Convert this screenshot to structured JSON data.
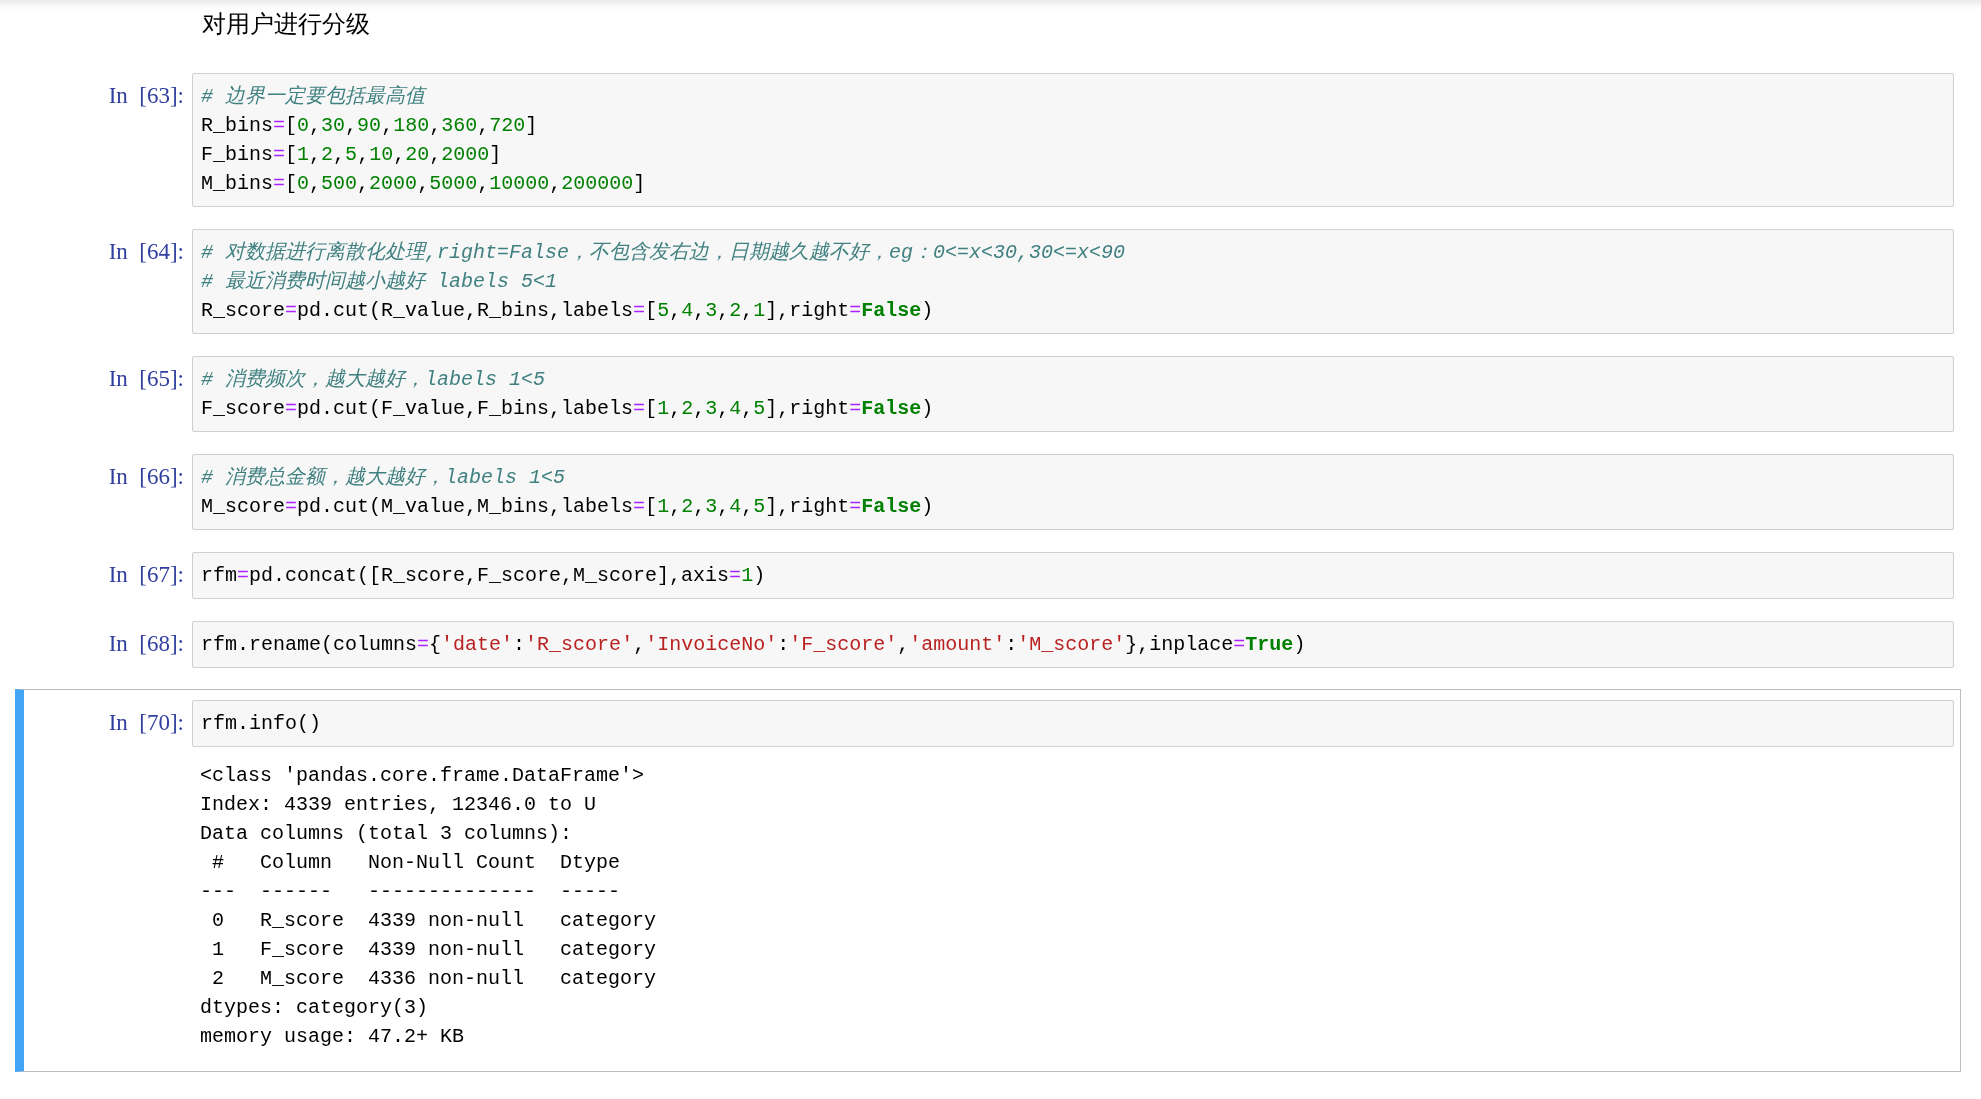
{
  "heading": "对用户进行分级",
  "cells": [
    {
      "prompt": "In  [63]:",
      "selected": false,
      "lines": [
        [
          {
            "kind": "comment",
            "text": "# 边界一定要包括最高值"
          }
        ],
        [
          {
            "kind": "plain",
            "text": "R_bins"
          },
          {
            "kind": "op",
            "text": "="
          },
          {
            "kind": "plain",
            "text": "["
          },
          {
            "kind": "num",
            "text": "0"
          },
          {
            "kind": "plain",
            "text": ","
          },
          {
            "kind": "num",
            "text": "30"
          },
          {
            "kind": "plain",
            "text": ","
          },
          {
            "kind": "num",
            "text": "90"
          },
          {
            "kind": "plain",
            "text": ","
          },
          {
            "kind": "num",
            "text": "180"
          },
          {
            "kind": "plain",
            "text": ","
          },
          {
            "kind": "num",
            "text": "360"
          },
          {
            "kind": "plain",
            "text": ","
          },
          {
            "kind": "num",
            "text": "720"
          },
          {
            "kind": "plain",
            "text": "]"
          }
        ],
        [
          {
            "kind": "plain",
            "text": "F_bins"
          },
          {
            "kind": "op",
            "text": "="
          },
          {
            "kind": "plain",
            "text": "["
          },
          {
            "kind": "num",
            "text": "1"
          },
          {
            "kind": "plain",
            "text": ","
          },
          {
            "kind": "num",
            "text": "2"
          },
          {
            "kind": "plain",
            "text": ","
          },
          {
            "kind": "num",
            "text": "5"
          },
          {
            "kind": "plain",
            "text": ","
          },
          {
            "kind": "num",
            "text": "10"
          },
          {
            "kind": "plain",
            "text": ","
          },
          {
            "kind": "num",
            "text": "20"
          },
          {
            "kind": "plain",
            "text": ","
          },
          {
            "kind": "num",
            "text": "2000"
          },
          {
            "kind": "plain",
            "text": "]"
          }
        ],
        [
          {
            "kind": "plain",
            "text": "M_bins"
          },
          {
            "kind": "op",
            "text": "="
          },
          {
            "kind": "plain",
            "text": "["
          },
          {
            "kind": "num",
            "text": "0"
          },
          {
            "kind": "plain",
            "text": ","
          },
          {
            "kind": "num",
            "text": "500"
          },
          {
            "kind": "plain",
            "text": ","
          },
          {
            "kind": "num",
            "text": "2000"
          },
          {
            "kind": "plain",
            "text": ","
          },
          {
            "kind": "num",
            "text": "5000"
          },
          {
            "kind": "plain",
            "text": ","
          },
          {
            "kind": "num",
            "text": "10000"
          },
          {
            "kind": "plain",
            "text": ","
          },
          {
            "kind": "num",
            "text": "200000"
          },
          {
            "kind": "plain",
            "text": "]"
          }
        ]
      ]
    },
    {
      "prompt": "In  [64]:",
      "selected": false,
      "lines": [
        [
          {
            "kind": "comment",
            "text": "# 对数据进行离散化处理,right=False，不包含发右边，日期越久越不好，eg：0<=x<30,30<=x<90"
          }
        ],
        [
          {
            "kind": "comment",
            "text": "# 最近消费时间越小越好 labels 5<1"
          }
        ],
        [
          {
            "kind": "plain",
            "text": "R_score"
          },
          {
            "kind": "op",
            "text": "="
          },
          {
            "kind": "plain",
            "text": "pd.cut(R_value,R_bins,labels"
          },
          {
            "kind": "op",
            "text": "="
          },
          {
            "kind": "plain",
            "text": "["
          },
          {
            "kind": "num",
            "text": "5"
          },
          {
            "kind": "plain",
            "text": ","
          },
          {
            "kind": "num",
            "text": "4"
          },
          {
            "kind": "plain",
            "text": ","
          },
          {
            "kind": "num",
            "text": "3"
          },
          {
            "kind": "plain",
            "text": ","
          },
          {
            "kind": "num",
            "text": "2"
          },
          {
            "kind": "plain",
            "text": ","
          },
          {
            "kind": "num",
            "text": "1"
          },
          {
            "kind": "plain",
            "text": "],right"
          },
          {
            "kind": "op",
            "text": "="
          },
          {
            "kind": "keyword",
            "text": "False"
          },
          {
            "kind": "plain",
            "text": ")"
          }
        ]
      ]
    },
    {
      "prompt": "In  [65]:",
      "selected": false,
      "lines": [
        [
          {
            "kind": "comment",
            "text": "# 消费频次，越大越好，labels 1<5"
          }
        ],
        [
          {
            "kind": "plain",
            "text": "F_score"
          },
          {
            "kind": "op",
            "text": "="
          },
          {
            "kind": "plain",
            "text": "pd.cut(F_value,F_bins,labels"
          },
          {
            "kind": "op",
            "text": "="
          },
          {
            "kind": "plain",
            "text": "["
          },
          {
            "kind": "num",
            "text": "1"
          },
          {
            "kind": "plain",
            "text": ","
          },
          {
            "kind": "num",
            "text": "2"
          },
          {
            "kind": "plain",
            "text": ","
          },
          {
            "kind": "num",
            "text": "3"
          },
          {
            "kind": "plain",
            "text": ","
          },
          {
            "kind": "num",
            "text": "4"
          },
          {
            "kind": "plain",
            "text": ","
          },
          {
            "kind": "num",
            "text": "5"
          },
          {
            "kind": "plain",
            "text": "],right"
          },
          {
            "kind": "op",
            "text": "="
          },
          {
            "kind": "keyword",
            "text": "False"
          },
          {
            "kind": "plain",
            "text": ")"
          }
        ]
      ]
    },
    {
      "prompt": "In  [66]:",
      "selected": false,
      "lines": [
        [
          {
            "kind": "comment",
            "text": "# 消费总金额，越大越好，labels 1<5"
          }
        ],
        [
          {
            "kind": "plain",
            "text": "M_score"
          },
          {
            "kind": "op",
            "text": "="
          },
          {
            "kind": "plain",
            "text": "pd.cut(M_value,M_bins,labels"
          },
          {
            "kind": "op",
            "text": "="
          },
          {
            "kind": "plain",
            "text": "["
          },
          {
            "kind": "num",
            "text": "1"
          },
          {
            "kind": "plain",
            "text": ","
          },
          {
            "kind": "num",
            "text": "2"
          },
          {
            "kind": "plain",
            "text": ","
          },
          {
            "kind": "num",
            "text": "3"
          },
          {
            "kind": "plain",
            "text": ","
          },
          {
            "kind": "num",
            "text": "4"
          },
          {
            "kind": "plain",
            "text": ","
          },
          {
            "kind": "num",
            "text": "5"
          },
          {
            "kind": "plain",
            "text": "],right"
          },
          {
            "kind": "op",
            "text": "="
          },
          {
            "kind": "keyword",
            "text": "False"
          },
          {
            "kind": "plain",
            "text": ")"
          }
        ]
      ]
    },
    {
      "prompt": "In  [67]:",
      "selected": false,
      "lines": [
        [
          {
            "kind": "plain",
            "text": "rfm"
          },
          {
            "kind": "op",
            "text": "="
          },
          {
            "kind": "plain",
            "text": "pd.concat([R_score,F_score,M_score],axis"
          },
          {
            "kind": "op",
            "text": "="
          },
          {
            "kind": "num",
            "text": "1"
          },
          {
            "kind": "plain",
            "text": ")"
          }
        ]
      ]
    },
    {
      "prompt": "In  [68]:",
      "selected": false,
      "lines": [
        [
          {
            "kind": "plain",
            "text": "rfm.rename(columns"
          },
          {
            "kind": "op",
            "text": "="
          },
          {
            "kind": "plain",
            "text": "{"
          },
          {
            "kind": "str",
            "text": "'date'"
          },
          {
            "kind": "plain",
            "text": ":"
          },
          {
            "kind": "str",
            "text": "'R_score'"
          },
          {
            "kind": "plain",
            "text": ","
          },
          {
            "kind": "str",
            "text": "'InvoiceNo'"
          },
          {
            "kind": "plain",
            "text": ":"
          },
          {
            "kind": "str",
            "text": "'F_score'"
          },
          {
            "kind": "plain",
            "text": ","
          },
          {
            "kind": "str",
            "text": "'amount'"
          },
          {
            "kind": "plain",
            "text": ":"
          },
          {
            "kind": "str",
            "text": "'M_score'"
          },
          {
            "kind": "plain",
            "text": "},inplace"
          },
          {
            "kind": "op",
            "text": "="
          },
          {
            "kind": "keyword",
            "text": "True"
          },
          {
            "kind": "plain",
            "text": ")"
          }
        ]
      ]
    },
    {
      "prompt": "In  [70]:",
      "selected": true,
      "lines": [
        [
          {
            "kind": "plain",
            "text": "rfm.info()"
          }
        ]
      ],
      "output": [
        "<class 'pandas.core.frame.DataFrame'>",
        "Index: 4339 entries, 12346.0 to U",
        "Data columns (total 3 columns):",
        " #   Column   Non-Null Count  Dtype",
        "---  ------   --------------  -----",
        " 0   R_score  4339 non-null   category",
        " 1   F_score  4339 non-null   category",
        " 2   M_score  4336 non-null   category",
        "dtypes: category(3)",
        "memory usage: 47.2+ KB"
      ]
    }
  ]
}
